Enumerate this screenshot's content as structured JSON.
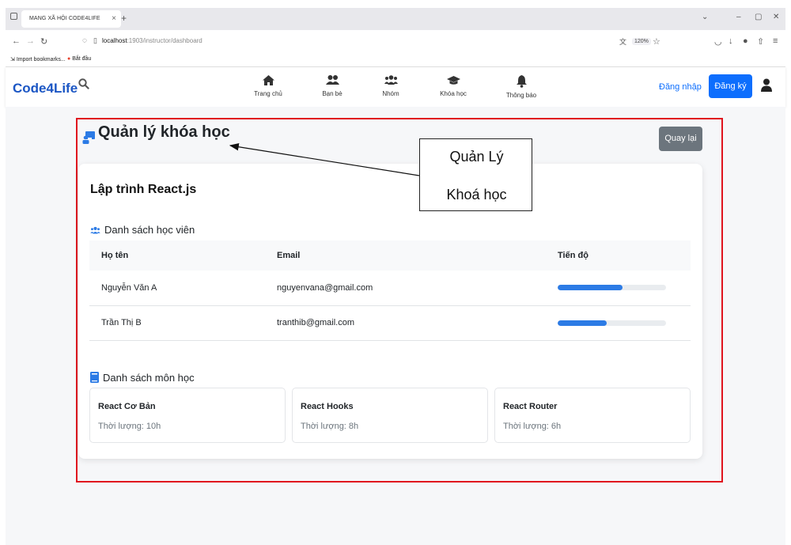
{
  "browser": {
    "tab_title": "MANG XÃ HỘI CODE4LIFE",
    "tab_close": "×",
    "new_tab": "+",
    "url_host": "localhost",
    "url_path": ":1903/instructor/dashboard",
    "zoom": "120%",
    "bookmarks": [
      "Import bookmarks...",
      "Bắt đầu"
    ]
  },
  "app": {
    "brand": "Code4Life",
    "nav_items": [
      {
        "label": "Trang chủ",
        "icon": "home-icon"
      },
      {
        "label": "Bạn bè",
        "icon": "friends-icon"
      },
      {
        "label": "Nhóm",
        "icon": "group-icon"
      },
      {
        "label": "Khóa học",
        "icon": "graduation-cap-icon"
      },
      {
        "label": "Thông báo",
        "icon": "bell-icon"
      }
    ],
    "login_label": "Đăng nhập",
    "signup_label": "Đăng ký"
  },
  "page": {
    "title": "Quản lý khóa học",
    "back_label": "Quay lại",
    "course_title": "Lập trình React.js",
    "students_heading": "Danh sách học viên",
    "columns": [
      "Họ tên",
      "Email",
      "Tiến độ"
    ],
    "students": [
      {
        "name": "Nguyễn Văn A",
        "email": "nguyenvana@gmail.com",
        "progress": 0.6
      },
      {
        "name": "Trần Thị B",
        "email": "tranthib@gmail.com",
        "progress": 0.45
      }
    ],
    "subjects_heading": "Danh sách môn học",
    "subjects": [
      {
        "name": "React Cơ Bản",
        "duration": "Thời lượng: 10h"
      },
      {
        "name": "React Hooks",
        "duration": "Thời lượng: 8h"
      },
      {
        "name": "React Router",
        "duration": "Thời lượng: 6h"
      }
    ]
  },
  "annotation": {
    "line1": "Quản Lý",
    "line2": "Khoá học",
    "box_color": "#e0141e"
  }
}
